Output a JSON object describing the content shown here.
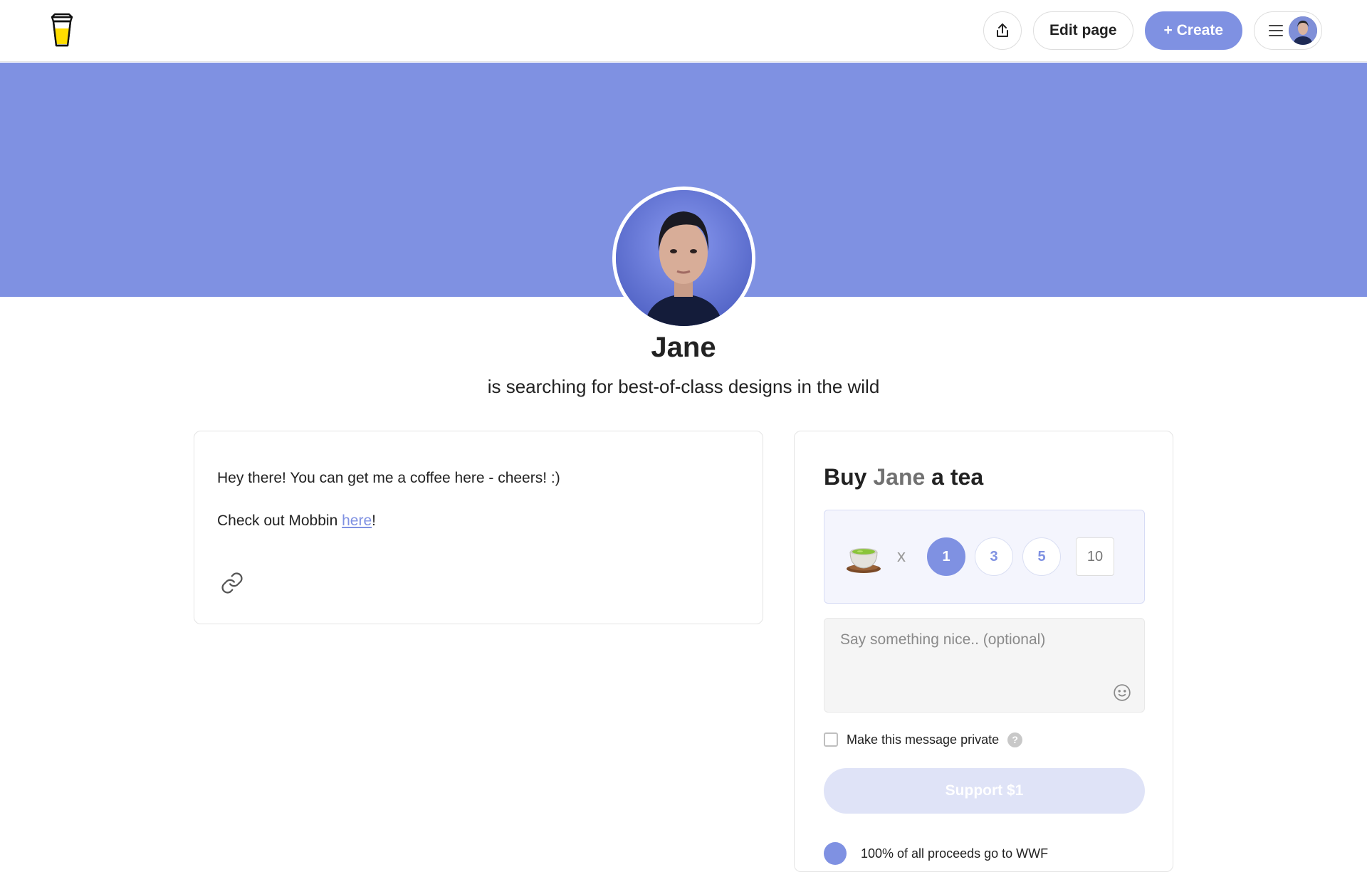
{
  "topbar": {
    "logo_icon": "coffee-cup-icon",
    "share_icon": "share-icon",
    "edit_label": "Edit page",
    "create_label": "+ Create",
    "menu_icon": "hamburger-menu-icon"
  },
  "profile": {
    "name": "Jane",
    "tagline": "is searching for best-of-class designs in the wild",
    "cover_color": "#7f91e2"
  },
  "about": {
    "line1": "Hey there! You can get me a coffee here - cheers! :)",
    "line2_prefix": "Check out Mobbin ",
    "line2_link": "here",
    "line2_suffix": "!",
    "link_icon": "link-icon"
  },
  "support": {
    "title_prefix": "Buy ",
    "title_name": "Jane",
    "title_suffix": " a tea",
    "item_icon": "tea-cup-icon",
    "times": "x",
    "quantities": [
      "1",
      "3",
      "5"
    ],
    "selected_quantity": "1",
    "custom_quantity_placeholder": "10",
    "message_placeholder": "Say something nice.. (optional)",
    "emoji_icon": "smiley-icon",
    "private_label": "Make this message private",
    "help_glyph": "?",
    "button_label": "Support $1",
    "proceeds_text": "100% of all proceeds go to WWF"
  },
  "colors": {
    "accent": "#7f91e2",
    "button_disabled": "#dfe3f7"
  }
}
